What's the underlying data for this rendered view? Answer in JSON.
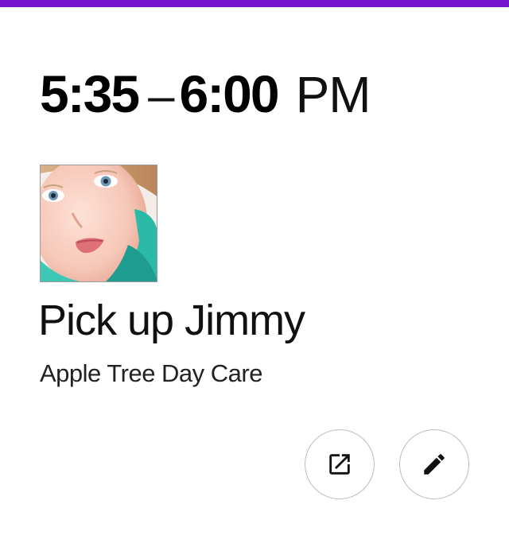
{
  "theme": {
    "accent_color": "#7514cc"
  },
  "event": {
    "time_start": "5:35",
    "time_separator": "–",
    "time_end": "6:00",
    "time_ampm": "PM",
    "title": "Pick up Jimmy",
    "location": "Apple Tree Day Care"
  },
  "avatar": {
    "icon": "child-photo"
  },
  "actions": {
    "open_icon": "open-in-new-icon",
    "edit_icon": "pencil-icon"
  }
}
